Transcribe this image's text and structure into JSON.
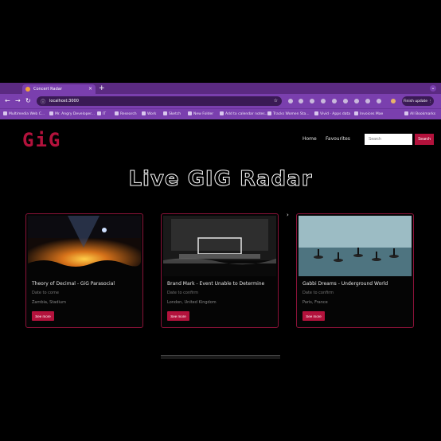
{
  "browser": {
    "tab_title": "Concert Radar",
    "tab_close": "×",
    "new_tab": "+",
    "tab_search_icon": "⌄",
    "url": "localhost:3000",
    "profile_chip": "Finish update ⋮",
    "back": "←",
    "forward": "→",
    "reload": "↻",
    "star": "☆",
    "lock": "ⓘ",
    "bookmarks": [
      "Multimedia Web C...",
      "Mr. Angry Developer...",
      "IT",
      "Research",
      "Work",
      "Sketch",
      "New Folder",
      "Add to calendar notes...",
      "Tracks Women Sta...",
      "Vivid · Apps data",
      "Invoices Mae",
      "All Bookmarks"
    ]
  },
  "site": {
    "logo": "GiG",
    "nav": {
      "home": "Home",
      "favorites": "Favourites"
    },
    "search": {
      "placeholder": "Search",
      "button": "Search"
    },
    "hero_title": "Live GIG Radar",
    "carousel_next": "›",
    "cards": [
      {
        "title": "Theory of Decimal - GiG Parasocial",
        "date": "Date to come",
        "location": "Zambia, Stadium",
        "button": "See more"
      },
      {
        "title": "Brand Mark - Event Unable to Determine",
        "date": "Date to confirm",
        "location": "London, United Kingdom",
        "button": "See more"
      },
      {
        "title": "Gabbi Dreams - Underground World",
        "date": "Date to confirm",
        "location": "Paris, France",
        "button": "See more"
      }
    ]
  },
  "colors": {
    "accent": "#b3123c",
    "browser_chrome": "#7a3fae",
    "background": "#000000"
  }
}
